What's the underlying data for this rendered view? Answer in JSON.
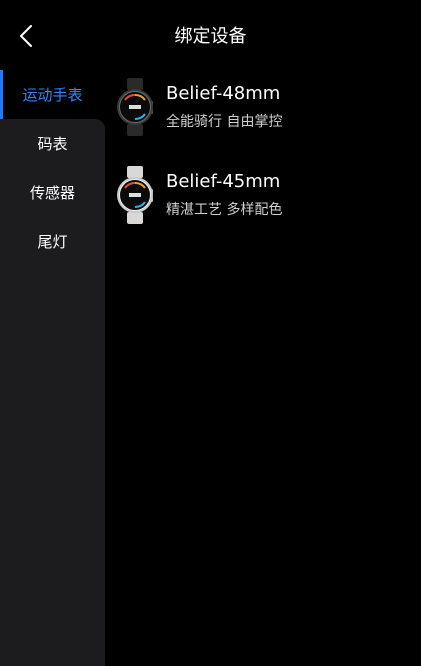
{
  "header": {
    "title": "绑定设备",
    "back_icon": "chevron-left-icon"
  },
  "sidebar": {
    "items": [
      {
        "label": "运动手表",
        "active": true
      },
      {
        "label": "码表",
        "active": false
      },
      {
        "label": "传感器",
        "active": false
      },
      {
        "label": "尾灯",
        "active": false
      }
    ]
  },
  "devices": [
    {
      "name": "Belief-48mm",
      "desc": "全能骑行 自由掌控",
      "icon": "black-smartwatch-image"
    },
    {
      "name": "Belief-45mm",
      "desc": "精湛工艺 多样配色",
      "icon": "silver-smartwatch-image"
    }
  ],
  "colors": {
    "background": "#000000",
    "sidebar": "#1c1c1e",
    "accent": "#1e7bff"
  }
}
